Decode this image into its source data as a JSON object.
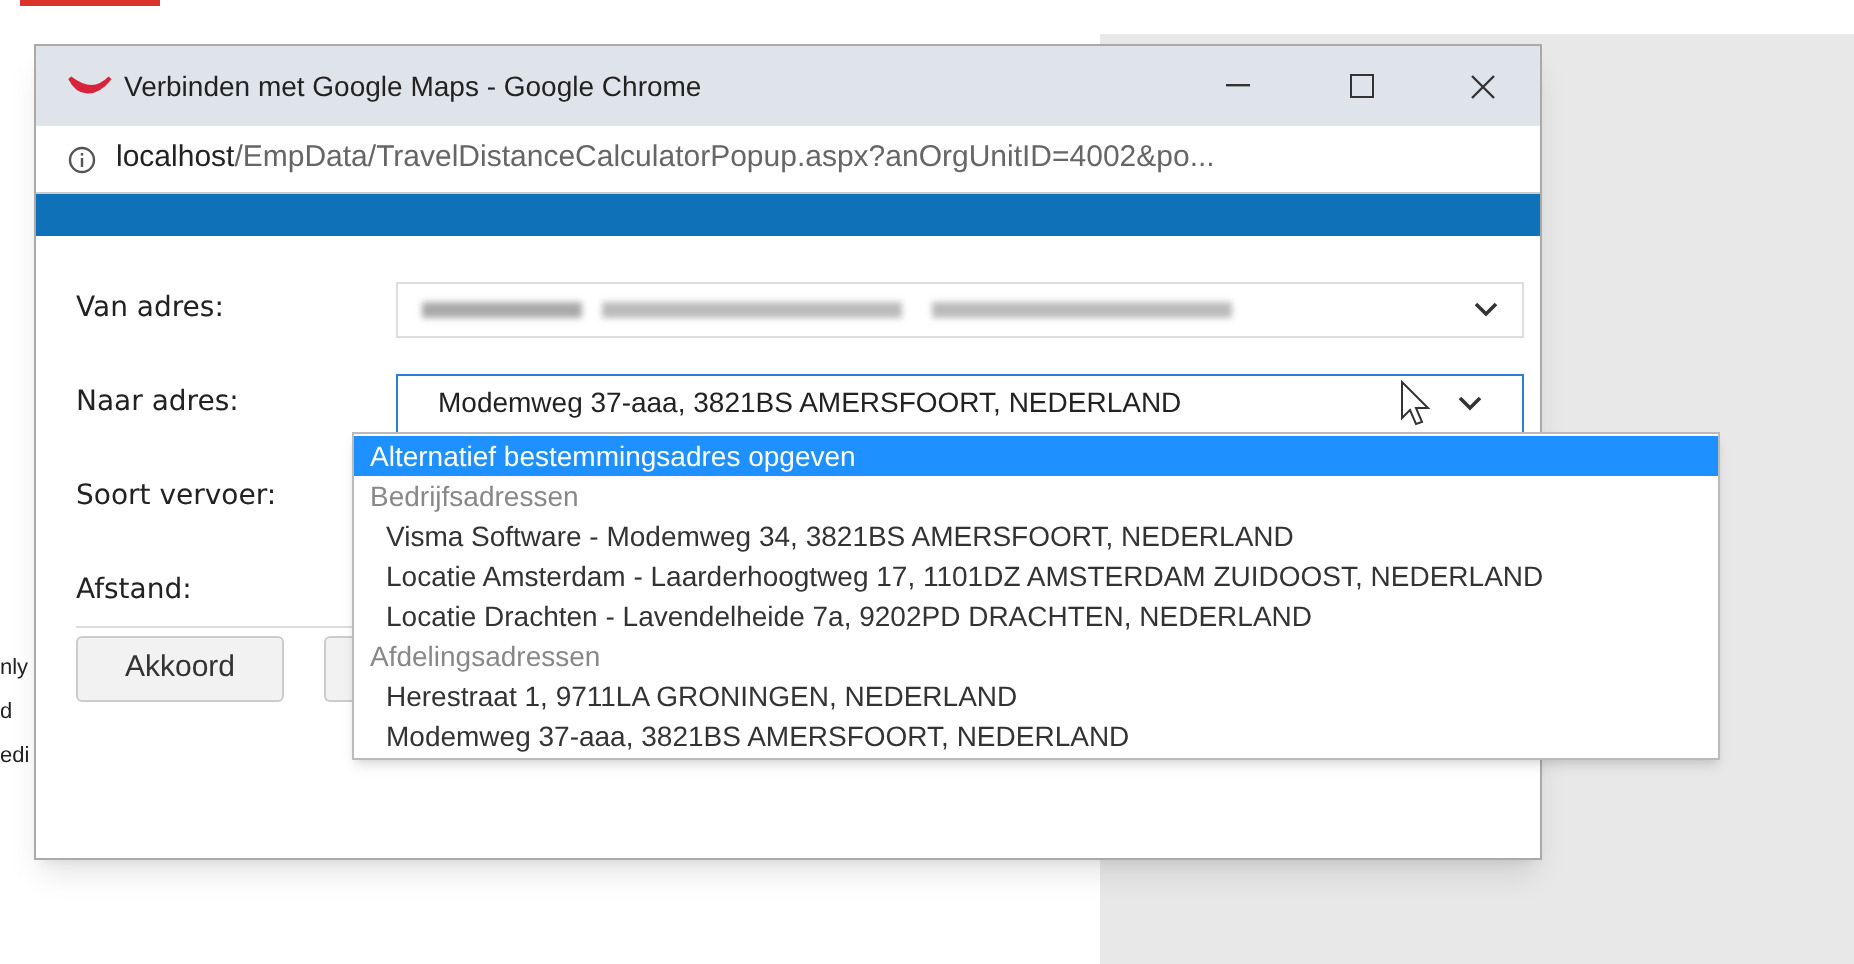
{
  "background": {
    "text_lines": [
      "nly",
      "d",
      "edi"
    ]
  },
  "window": {
    "title": "Verbinden met Google Maps - Google Chrome",
    "url_host": "localhost",
    "url_path": "/EmpData/TravelDistanceCalculatorPopup.aspx?anOrgUnitID=4002&po..."
  },
  "form": {
    "fields": [
      {
        "label": "Van adres:",
        "kind": "blurred-select"
      },
      {
        "label": "Naar adres:",
        "kind": "select",
        "value": "Modemweg 37-aaa, 3821BS AMERSFOORT, NEDERLAND",
        "expanded": true
      },
      {
        "label": "Soort vervoer:",
        "kind": "hidden"
      },
      {
        "label": "Afstand:",
        "kind": "hidden"
      }
    ],
    "buttons": [
      {
        "label": "Akkoord",
        "kind": "text"
      },
      {
        "kind": "covered"
      }
    ]
  },
  "dropdown": {
    "items": [
      {
        "kind": "option",
        "label": "Alternatief bestemmingsadres opgeven",
        "selected": true
      },
      {
        "kind": "group",
        "label": "Bedrijfsadressen"
      },
      {
        "kind": "option",
        "label": "Visma Software - Modemweg 34, 3821BS AMERSFOORT, NEDERLAND",
        "selected": false
      },
      {
        "kind": "option",
        "label": "Locatie Amsterdam - Laarderhoogtweg 17, 1101DZ AMSTERDAM ZUIDOOST, NEDERLAND",
        "selected": false
      },
      {
        "kind": "option",
        "label": "Locatie Drachten - Lavendelheide 7a, 9202PD DRACHTEN, NEDERLAND",
        "selected": false
      },
      {
        "kind": "group",
        "label": "Afdelingsadressen"
      },
      {
        "kind": "option",
        "label": "Herestraat 1, 9711LA GRONINGEN, NEDERLAND",
        "selected": false
      },
      {
        "kind": "option",
        "label": "Modemweg 37-aaa, 3821BS AMERSFOORT, NEDERLAND",
        "selected": false
      }
    ]
  }
}
